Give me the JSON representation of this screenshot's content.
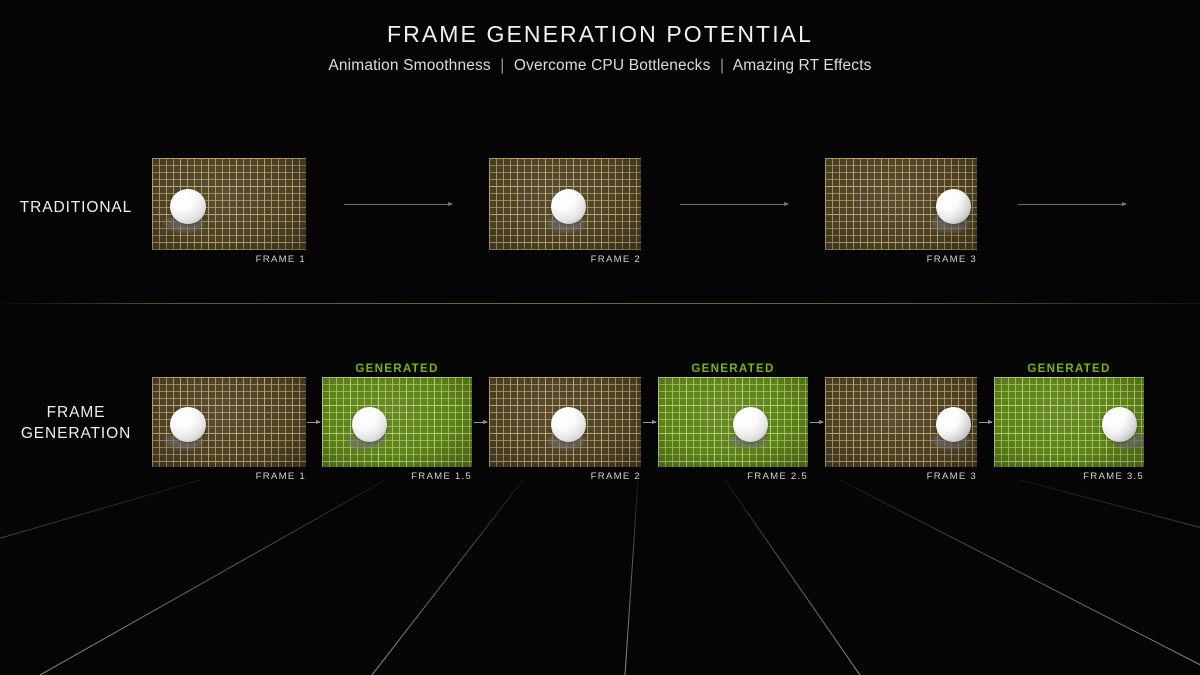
{
  "header": {
    "title": "FRAME GENERATION POTENTIAL",
    "sub1": "Animation Smoothness",
    "sep1": "|",
    "sub2": "Overcome CPU Bottlenecks",
    "sep2": "|",
    "sub3": "Amazing RT Effects"
  },
  "colors": {
    "accent_green": "#76b900",
    "traditional_surface": "#4b4127",
    "generated_surface": "#5e8119",
    "background": "#050505",
    "divider": "#8a7648"
  },
  "rows": [
    {
      "id": "traditional",
      "label": "TRADITIONAL",
      "frames": [
        {
          "caption": "FRAME 1",
          "kind": "rendered",
          "tag": "",
          "ball_x_pct": 17
        },
        {
          "caption": "FRAME 2",
          "kind": "rendered",
          "tag": "",
          "ball_x_pct": 46
        },
        {
          "caption": "FRAME 3",
          "kind": "rendered",
          "tag": "",
          "ball_x_pct": 79
        }
      ]
    },
    {
      "id": "frame-generation",
      "label_line1": "FRAME",
      "label_line2": "GENERATION",
      "frames": [
        {
          "caption": "FRAME 1",
          "kind": "rendered",
          "tag": "",
          "ball_x_pct": 17
        },
        {
          "caption": "FRAME 1.5",
          "kind": "generated",
          "tag": "GENERATED",
          "ball_x_pct": 25
        },
        {
          "caption": "FRAME 2",
          "kind": "rendered",
          "tag": "",
          "ball_x_pct": 46
        },
        {
          "caption": "FRAME 2.5",
          "kind": "generated",
          "tag": "GENERATED",
          "ball_x_pct": 56
        },
        {
          "caption": "FRAME 3",
          "kind": "rendered",
          "tag": "",
          "ball_x_pct": 79
        },
        {
          "caption": "FRAME 3.5",
          "kind": "generated",
          "tag": "GENERATED",
          "ball_x_pct": 87
        }
      ]
    }
  ]
}
